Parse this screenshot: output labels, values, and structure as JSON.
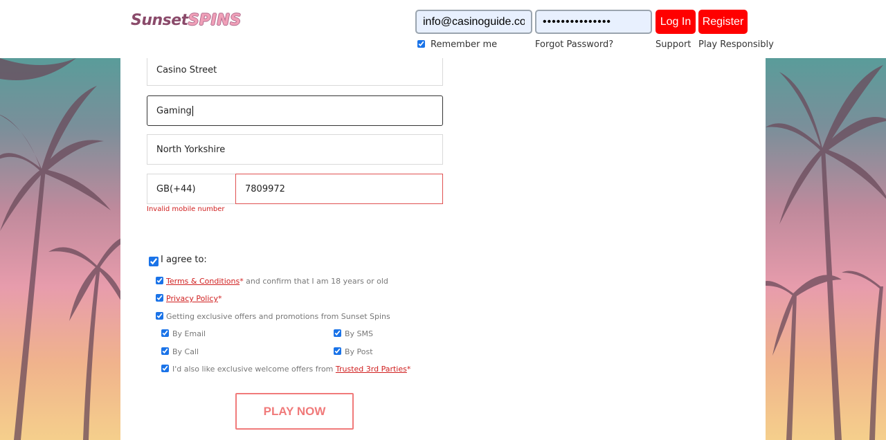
{
  "brand": {
    "logo_part1": "Sunset",
    "logo_part2": "SPINS"
  },
  "header": {
    "email_value": "info@casinoguide.com",
    "password_value": "•••••••••••••••",
    "login_label": "Log In",
    "register_label": "Register",
    "remember_label": "Remember me",
    "remember_checked": true,
    "forgot_label": "Forgot Password?",
    "support_label": "Support",
    "play_responsibly_label": "Play Responsibly"
  },
  "form": {
    "street_value": "Casino Street",
    "city_value": "Gaming",
    "county_value": "North Yorkshire",
    "phone_prefix": "GB(+44)",
    "mobile_value": "7809972",
    "mobile_error": "Invalid mobile number",
    "agree_label": "I agree to:",
    "terms_link": "Terms & Conditions",
    "terms_rest": " and confirm that I am 18 years or old",
    "privacy_link": "Privacy Policy",
    "required_mark": "*",
    "offers_label": "Getting exclusive offers and promotions from Sunset Spins",
    "by_email": "By Email",
    "by_sms": "By SMS",
    "by_call": "By Call",
    "by_post": "By Post",
    "third_party_text": "I'd also like exclusive welcome offers from ",
    "third_party_link": "Trusted 3rd Parties",
    "play_now_label": "PLAY NOW"
  },
  "colors": {
    "accent_red": "#ff0000",
    "error_red": "#d02020",
    "play_button": "#f07a7a",
    "checkbox_blue": "#1a73e8"
  }
}
